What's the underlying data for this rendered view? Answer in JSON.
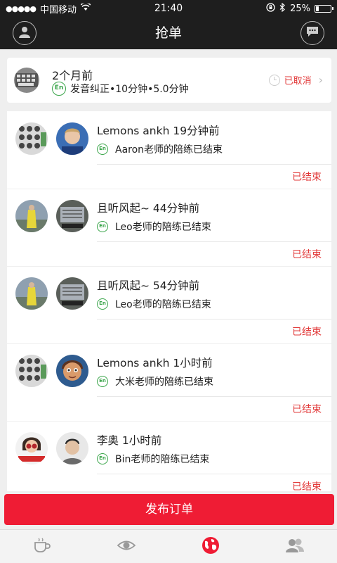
{
  "status_bar": {
    "carrier": "中国移动",
    "time": "21:40",
    "battery": "25%",
    "battery_level": 0.25
  },
  "header": {
    "title": "抢单",
    "left_icon": "profile-icon",
    "right_icon": "chat-icon"
  },
  "pending": {
    "time": "2个月前",
    "lang_badge": "En",
    "detail": "发音纠正•10分钟•5.0分钟",
    "status": "已取消"
  },
  "orders": [
    {
      "title": "Lemons ankh 19分钟前",
      "badge": "En",
      "desc": "Aaron老师的陪练已结束",
      "status": "已结束"
    },
    {
      "title": "且听风起~ 44分钟前",
      "badge": "En",
      "desc": "Leo老师的陪练已结束",
      "status": "已结束"
    },
    {
      "title": "且听风起~ 54分钟前",
      "badge": "En",
      "desc": "Leo老师的陪练已结束",
      "status": "已结束"
    },
    {
      "title": "Lemons ankh 1小时前",
      "badge": "En",
      "desc": "大米老师的陪练已结束",
      "status": "已结束"
    },
    {
      "title": "李奥 1小时前",
      "badge": "En",
      "desc": "Bin老师的陪练已结束",
      "status": "已结束"
    }
  ],
  "publish_button": "发布订单",
  "tabs": [
    {
      "icon": "coffee-icon",
      "active": false
    },
    {
      "icon": "eye-icon",
      "active": false
    },
    {
      "icon": "globe-icon",
      "active": true
    },
    {
      "icon": "group-icon",
      "active": false
    }
  ],
  "colors": {
    "accent": "#ef1c34",
    "status_red": "#e23a3a",
    "badge_green": "#3aa54a",
    "header_bg": "#1e1e1e"
  }
}
